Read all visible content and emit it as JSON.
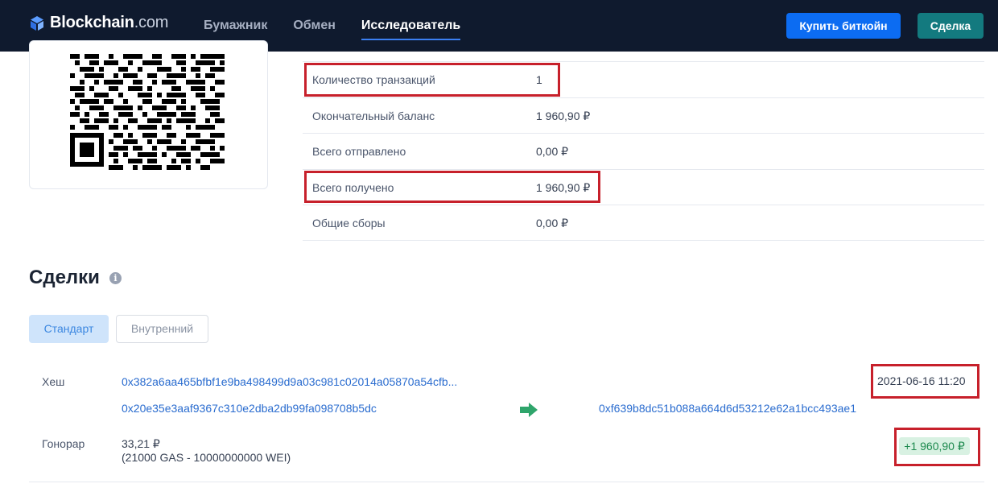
{
  "header": {
    "logo_main": "Blockchain",
    "logo_suffix": ".com",
    "nav": [
      "Бумажник",
      "Обмен",
      "Исследователь"
    ],
    "buy_button": "Купить биткойн",
    "trade_button": "Сделка",
    "colors": {
      "bar": "#0f1a2e",
      "buy": "#0c6cf2",
      "trade": "#137a7f"
    }
  },
  "address_info": [
    {
      "label": "Количество транзакций",
      "value": "1"
    },
    {
      "label": "Окончательный баланс",
      "value": "1 960,90 ₽"
    },
    {
      "label": "Всего отправлено",
      "value": "0,00 ₽"
    },
    {
      "label": "Всего получено",
      "value": "1 960,90 ₽"
    },
    {
      "label": "Общие сборы",
      "value": "0,00 ₽"
    }
  ],
  "transactions_section": {
    "title": "Сделки",
    "info_icon": "info-circle-icon",
    "tabs": [
      "Стандарт",
      "Внутренний"
    ]
  },
  "transaction": {
    "hash_label": "Хеш",
    "hash": "0x382a6aa465bfbf1e9ba498499d9a03c981c02014a05870a54cfb...",
    "from": "0x20e35e3aaf9367c310e2dba2db99fa098708b5dc",
    "arrow_icon": "arrow-right-icon",
    "to": "0xf639b8dc51b088a664d6d53212e62a1bcc493ae1",
    "timestamp": "2021-06-16 11:20",
    "fee_label": "Гонорар",
    "fee": "33,21 ₽",
    "fee_detail": "(21000 GAS - 10000000000 WEI)",
    "amount": "+1 960,90 ₽"
  },
  "highlight_color": "#c7202b"
}
